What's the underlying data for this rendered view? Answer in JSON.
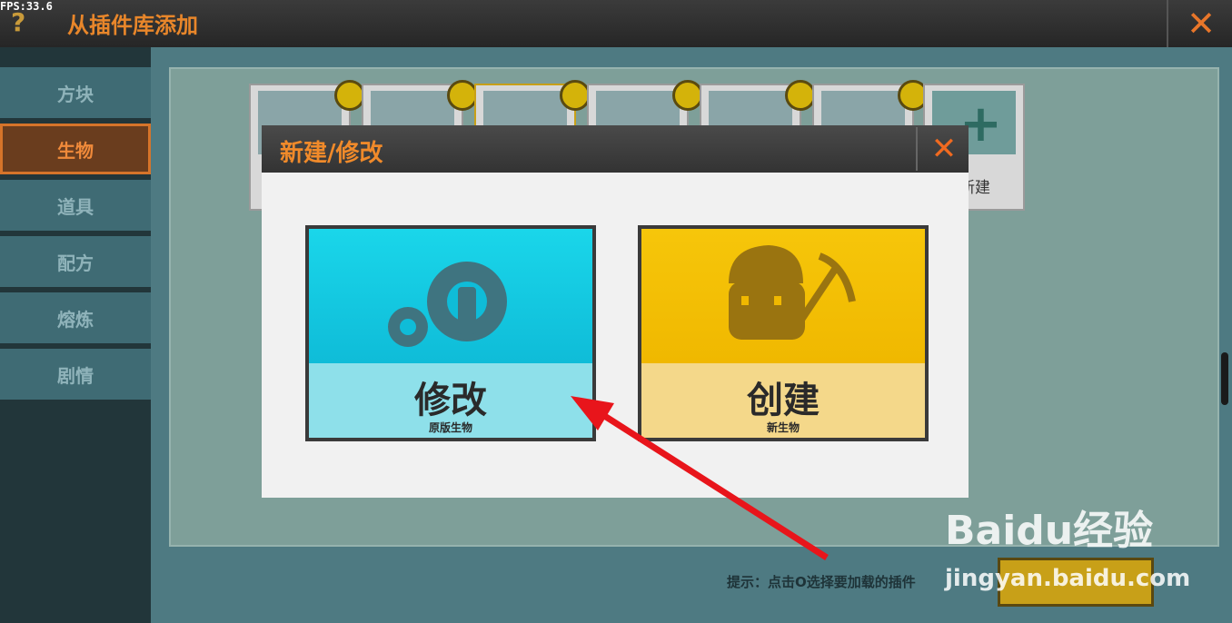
{
  "fps_counter": "FPS:33.6",
  "header": {
    "help_glyph": "?",
    "title": "从插件库添加",
    "close_glyph": "✕"
  },
  "sidebar": {
    "items": [
      {
        "label": "方块",
        "active": false
      },
      {
        "label": "生物",
        "active": true
      },
      {
        "label": "道具",
        "active": false
      },
      {
        "label": "配方",
        "active": false
      },
      {
        "label": "熔炼",
        "active": false
      },
      {
        "label": "剧情",
        "active": false
      }
    ]
  },
  "plugins": {
    "add_glyph": "+",
    "add_label": "新建"
  },
  "dialog": {
    "title": "新建/修改",
    "close_glyph": "✕",
    "options": [
      {
        "label": "修改",
        "sub": "原版生物",
        "icon": "gears-wrench-icon"
      },
      {
        "label": "创建",
        "sub": "新生物",
        "icon": "miner-pickaxe-icon"
      }
    ]
  },
  "footer": {
    "hint": "提示：点击O选择要加载的插件"
  },
  "watermark": {
    "logo": "Baidu经验",
    "url": "jingyan.baidu.com"
  },
  "colors": {
    "accent": "#f08a2a",
    "modify": "#1ad6ea",
    "create": "#f6c60a"
  }
}
